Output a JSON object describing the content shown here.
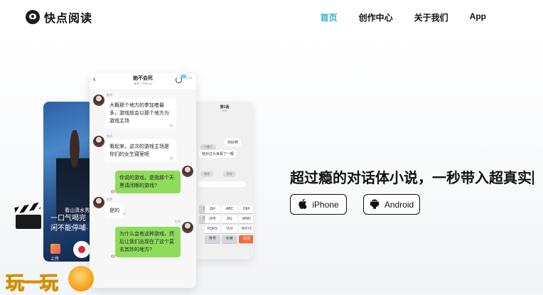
{
  "header": {
    "app_name": "快点阅读",
    "nav": [
      {
        "label": "首页",
        "active": true
      },
      {
        "label": "创作中心",
        "active": false
      },
      {
        "label": "关于我们",
        "active": false
      },
      {
        "label": "App",
        "active": false
      }
    ]
  },
  "hero": {
    "headline": "超过瘾的对话体小说，一秒带入超真实",
    "buttons": {
      "ios_label": "iPhone",
      "android_label": "Android"
    }
  },
  "photo_phone": {
    "caption_small": "看山清水秀",
    "caption_line1": "一口气喝完",
    "caption_line2": "闲不能停哺·",
    "upload_label": "上传"
  },
  "chat_phone": {
    "title": "她不会死",
    "subtitle": "著作 | 共享Ing",
    "refresh_badge": "15",
    "messages": [
      {
        "side": "left",
        "name": "那哥",
        "text": "大概那个地方的参加者最多，游戏就会以那个地方为游戏主场",
        "badge": "2"
      },
      {
        "side": "left",
        "name": "那哥",
        "text": "看起来，这次的游戏主场是你们的女生寝室呢",
        "badge": "2"
      },
      {
        "side": "right",
        "name": "",
        "text": "你说的游戏，是指那个天黑请闭眼的游戏?",
        "badge": "5"
      },
      {
        "side": "left",
        "name": "那哥",
        "text": "是的",
        "badge": "2"
      },
      {
        "side": "right",
        "name": "白发",
        "text": "为什么会有这种游戏，然后让我们出现在了这个莫名其妙的地方?",
        "badge": "5"
      }
    ]
  },
  "keyboard_phone": {
    "title": "第1话",
    "subtitle": "作者",
    "bubble_1": "你好啊",
    "bubble_2": "他对过头来看了一眼",
    "chip_1": "我说",
    "chip_2": "别说",
    "name_tag": "大魔王",
    "keys": [
      "@#",
      "ABC",
      "DEF",
      "GHI",
      "JKL",
      "MNO",
      "PQRS",
      "TUV",
      "WXYZ",
      "符号",
      "中英",
      "发送"
    ],
    "extra_keys": [
      "分词",
      "⌫",
      "重输",
      "0"
    ]
  },
  "watermark": {
    "text": "玩一玩"
  }
}
